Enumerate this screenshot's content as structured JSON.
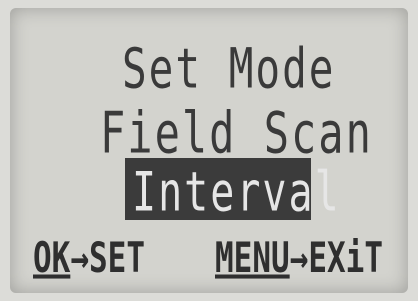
{
  "screen": {
    "title": "Set Mode",
    "item": "Field Scan",
    "selected": "Interval"
  },
  "footer": {
    "ok_key": "OK",
    "ok_arrow": "→",
    "ok_action": "SET",
    "menu_key": "MENU",
    "menu_arrow": "→",
    "menu_action": "EXiT"
  },
  "colors": {
    "lcd_bg": "#d3d3ce",
    "text": "#3a3a3a",
    "highlight_bg": "#3b3b3b",
    "highlight_text": "#e6e6e6"
  }
}
